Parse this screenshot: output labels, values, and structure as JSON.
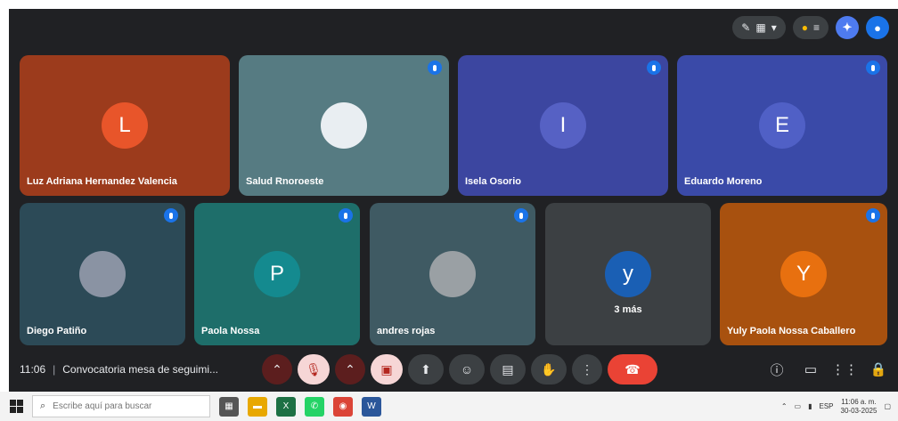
{
  "toolbar_top": {
    "pill_label": "▾",
    "people_badge": "≡"
  },
  "tiles": [
    {
      "name": "Luz Adriana Hernandez Valencia",
      "initial": "L",
      "bg": "#9c3b1c",
      "avatar_bg": "#e8552a",
      "muted": false
    },
    {
      "name": "Salud Rnoroeste",
      "initial": "",
      "bg": "#567b82",
      "avatar_bg": "#e9eef2",
      "muted": true
    },
    {
      "name": "Isela Osorio",
      "initial": "I",
      "bg": "#3c46a0",
      "avatar_bg": "#5661c4",
      "muted": true
    },
    {
      "name": "Eduardo Moreno",
      "initial": "E",
      "bg": "#3a4aa8",
      "avatar_bg": "#5060c6",
      "muted": true
    },
    {
      "name": "Diego Patiño",
      "initial": "",
      "bg": "#2c4a57",
      "avatar_bg": "#8a93a3",
      "muted": true
    },
    {
      "name": "Paola Nossa",
      "initial": "P",
      "bg": "#1e6e6a",
      "avatar_bg": "#148a8f",
      "muted": true
    },
    {
      "name": "andres rojas",
      "initial": "",
      "bg": "#3f5a63",
      "avatar_bg": "#9aa0a4",
      "muted": true
    },
    {
      "name": "3 más",
      "initial": "y",
      "bg": "#3c4043",
      "avatar_bg": "#1a5fb4",
      "muted": false
    },
    {
      "name": "Yuly Paola Nossa Caballero",
      "initial": "Y",
      "bg": "#a8510f",
      "avatar_bg": "#e8700f",
      "muted": true
    }
  ],
  "bottom": {
    "time": "11:06",
    "separator": "|",
    "meeting_title": "Convocatoria mesa de seguimi..."
  },
  "taskbar": {
    "search_placeholder": "Escribe aquí para buscar",
    "tray_lang": "ESP",
    "tray_time": "11:06 a. m.",
    "tray_date": "30-03-2025"
  },
  "colors": {
    "meet_bg": "#202124",
    "hangup": "#ea4335",
    "accent": "#1a73e8"
  }
}
